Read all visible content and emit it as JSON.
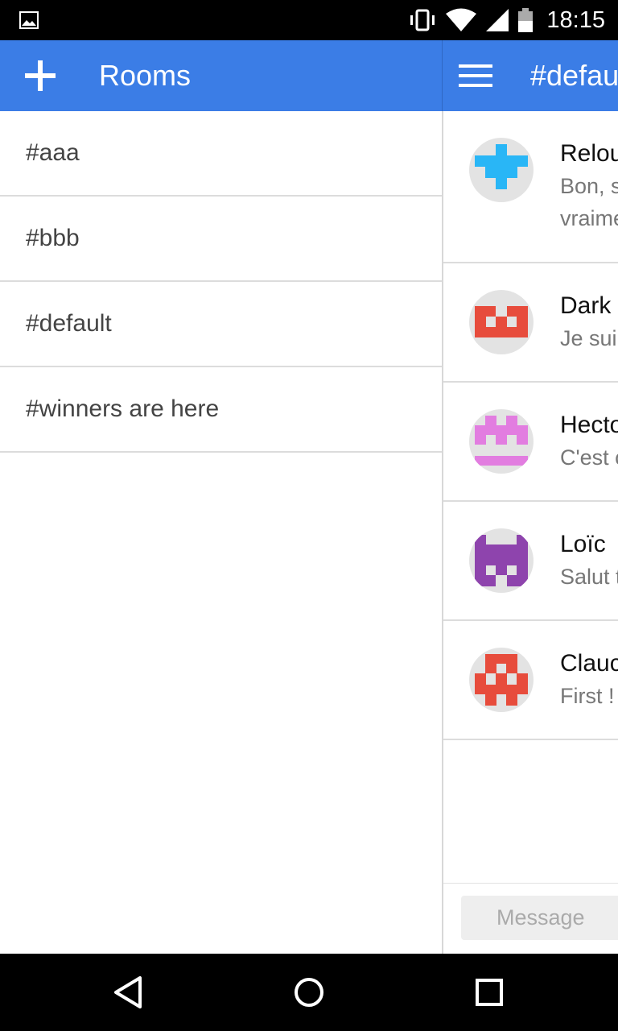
{
  "status_bar": {
    "time": "18:15",
    "icons": [
      "image-notification-icon",
      "vibrate-icon",
      "wifi-icon",
      "signal-icon",
      "battery-icon"
    ]
  },
  "rooms_header": {
    "title": "Rooms",
    "add_icon": "plus-icon"
  },
  "rooms": [
    {
      "label": "#aaa"
    },
    {
      "label": "#bbb"
    },
    {
      "label": "#default"
    },
    {
      "label": "#winners are here"
    }
  ],
  "chat_header": {
    "title": "#defau",
    "menu_icon": "hamburger-menu-icon"
  },
  "messages": [
    {
      "author": "Relou",
      "lines": [
        "Bon, s",
        "vraime"
      ],
      "avatar_color": "#29b6f6"
    },
    {
      "author": "Dark",
      "lines": [
        "Je sui"
      ],
      "avatar_color": "#e74c3c"
    },
    {
      "author": "Hecto",
      "lines": [
        "C'est c"
      ],
      "avatar_color": "#e27de0"
    },
    {
      "author": "Loïc",
      "lines": [
        "Salut t"
      ],
      "avatar_color": "#8e44ad"
    },
    {
      "author": "Clauc",
      "lines": [
        "First !"
      ],
      "avatar_color": "#e74c3c"
    }
  ],
  "composer": {
    "placeholder": "Message"
  },
  "nav_bar": {
    "icons": [
      "back-icon",
      "home-icon",
      "recents-icon"
    ]
  },
  "colors": {
    "app_bar": "#3b7de6",
    "status_bar": "#000000",
    "divider": "#dcdcdc"
  }
}
